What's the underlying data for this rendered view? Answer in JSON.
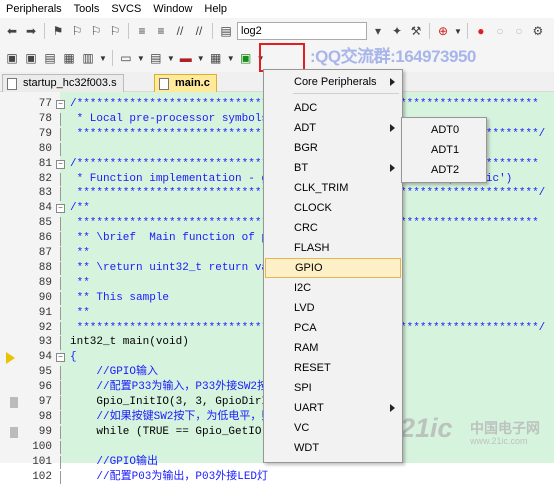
{
  "menubar": [
    "Peripherals",
    "Tools",
    "SVCS",
    "Window",
    "Help"
  ],
  "toolbar": {
    "target_combo": "log2"
  },
  "watermark_top": ":QQ交流群:164973950",
  "tabs": [
    {
      "label": "startup_hc32f003.s",
      "active": false
    },
    {
      "label": "main.c",
      "active": true
    }
  ],
  "code_lines": [
    {
      "n": "77",
      "t": "/**********************************************************************",
      "fold": true
    },
    {
      "n": "78",
      "t": " * Local pre-processor symbols/macros ('#define')"
    },
    {
      "n": "79",
      "t": " **********************************************************************/"
    },
    {
      "n": "80",
      "t": ""
    },
    {
      "n": "81",
      "t": "/**********************************************************************",
      "fold": true
    },
    {
      "n": "82",
      "t": " * Function implementation - global ('extern') and local ('static')"
    },
    {
      "n": "83",
      "t": " **********************************************************************/"
    },
    {
      "n": "84",
      "t": "/**",
      "fold": true
    },
    {
      "n": "85",
      "t": " **********************************************************************"
    },
    {
      "n": "86",
      "t": " ** \\brief  Main function of project"
    },
    {
      "n": "87",
      "t": " **"
    },
    {
      "n": "88",
      "t": " ** \\return uint32_t return value, if needed"
    },
    {
      "n": "89",
      "t": " **"
    },
    {
      "n": "90",
      "t": " ** This sample"
    },
    {
      "n": "91",
      "t": " **"
    },
    {
      "n": "92",
      "t": " **********************************************************************/"
    },
    {
      "n": "93",
      "t": "int32_t main(void)",
      "k": true
    },
    {
      "n": "94",
      "t": "{",
      "fold": true,
      "arrow": true
    },
    {
      "n": "95",
      "t": "    //GPIO输入"
    },
    {
      "n": "96",
      "t": "    //配置P33为输入，P33外接SW2按键"
    },
    {
      "n": "97",
      "t": "    Gpio_InitIO(3, 3, GpioDirIn);",
      "k": true,
      "bp": true
    },
    {
      "n": "98",
      "t": "    //如果按键SW2按下，为低电平，则跳出循环继续执行程序"
    },
    {
      "n": "99",
      "t": "    while (TRUE == Gpio_GetIO(3, 3));",
      "k": true,
      "bp": true
    },
    {
      "n": "100",
      "t": ""
    },
    {
      "n": "101",
      "t": "    //GPIO输出"
    },
    {
      "n": "102",
      "t": "    //配置P03为输出，P03外接LED灯"
    }
  ],
  "menu": {
    "items": [
      {
        "label": "Core Peripherals",
        "submenu": true
      },
      {
        "sep": true
      },
      {
        "label": "ADC"
      },
      {
        "label": "ADT",
        "submenu": true
      },
      {
        "label": "BGR"
      },
      {
        "label": "BT",
        "submenu": true
      },
      {
        "label": "CLK_TRIM"
      },
      {
        "label": "CLOCK"
      },
      {
        "label": "CRC"
      },
      {
        "label": "FLASH"
      },
      {
        "label": "GPIO",
        "selected": true
      },
      {
        "label": "I2C"
      },
      {
        "label": "LVD"
      },
      {
        "label": "PCA"
      },
      {
        "label": "RAM"
      },
      {
        "label": "RESET"
      },
      {
        "label": "SPI"
      },
      {
        "label": "UART",
        "submenu": true
      },
      {
        "label": "VC"
      },
      {
        "label": "WDT"
      }
    ]
  },
  "submenu_adt": [
    "ADT0",
    "ADT1",
    "ADT2"
  ],
  "watermark_bottom": {
    "logo": "21ic",
    "cn": "中国电子网",
    "url": "www.21ic.com"
  }
}
